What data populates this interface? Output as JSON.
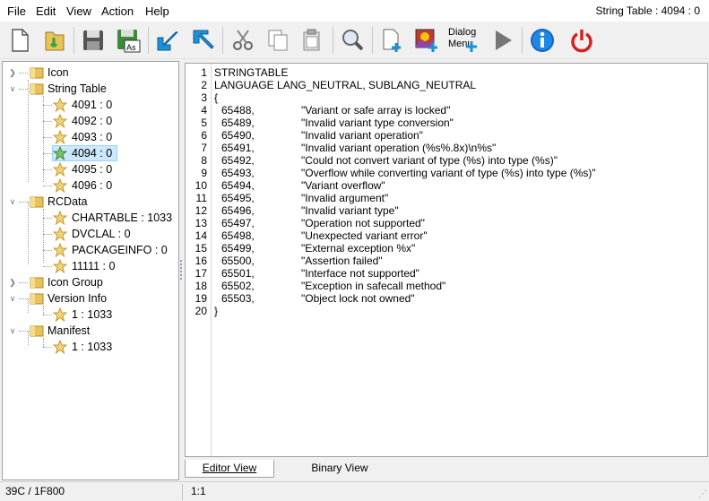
{
  "menu": {
    "file": "File",
    "edit": "Edit",
    "view": "View",
    "action": "Action",
    "help": "Help"
  },
  "window_status": "String Table : 4094 : 0",
  "toolbar": {
    "dialog_label_1": "Dialog",
    "dialog_label_2": "Menu",
    "icons": [
      "new-file-icon",
      "open-folder-icon",
      "save-icon",
      "save-as-icon",
      "arrow-back-icon",
      "arrow-forward-icon",
      "cut-icon",
      "copy-icon",
      "paste-icon",
      "search-icon",
      "add-resource-icon",
      "add-image-icon",
      "add-dialog-menu-icon",
      "play-icon",
      "info-icon",
      "power-icon"
    ]
  },
  "tree": {
    "icon": "Icon",
    "string_table": "String Table",
    "st_items": [
      "4091 : 0",
      "4092 : 0",
      "4093 : 0",
      "4094 : 0",
      "4095 : 0",
      "4096 : 0"
    ],
    "rcdata": "RCData",
    "rc_items": [
      "CHARTABLE : 1033",
      "DVCLAL : 0",
      "PACKAGEINFO : 0",
      "11111 : 0"
    ],
    "icon_group": "Icon Group",
    "version_info": "Version Info",
    "vi_items": [
      "1 : 1033"
    ],
    "manifest": "Manifest",
    "mf_items": [
      "1 : 1033"
    ]
  },
  "editor": {
    "line1": "STRINGTABLE",
    "line2": "LANGUAGE LANG_NEUTRAL, SUBLANG_NEUTRAL",
    "line3": "{",
    "entries": [
      {
        "id": "65488,",
        "text": "\"Variant or safe array is locked\""
      },
      {
        "id": "65489,",
        "text": "\"Invalid variant type conversion\""
      },
      {
        "id": "65490,",
        "text": "\"Invalid variant operation\""
      },
      {
        "id": "65491,",
        "text": "\"Invalid variant operation (%s%.8x)\\n%s\""
      },
      {
        "id": "65492,",
        "text": "\"Could not convert variant of type (%s) into type (%s)\""
      },
      {
        "id": "65493,",
        "text": "\"Overflow while converting variant of type (%s) into type (%s)\""
      },
      {
        "id": "65494,",
        "text": "\"Variant overflow\""
      },
      {
        "id": "65495,",
        "text": "\"Invalid argument\""
      },
      {
        "id": "65496,",
        "text": "\"Invalid variant type\""
      },
      {
        "id": "65497,",
        "text": "\"Operation not supported\""
      },
      {
        "id": "65498,",
        "text": "\"Unexpected variant error\""
      },
      {
        "id": "65499,",
        "text": "\"External exception %x\""
      },
      {
        "id": "65500,",
        "text": "\"Assertion failed\""
      },
      {
        "id": "65501,",
        "text": "\"Interface not supported\""
      },
      {
        "id": "65502,",
        "text": "\"Exception in safecall method\""
      },
      {
        "id": "65503,",
        "text": "\"Object lock not owned\""
      }
    ],
    "line20": "}",
    "line_numbers": [
      "1",
      "2",
      "3",
      "4",
      "5",
      "6",
      "7",
      "8",
      "9",
      "10",
      "11",
      "12",
      "13",
      "14",
      "15",
      "16",
      "17",
      "18",
      "19",
      "20"
    ]
  },
  "tabs": {
    "editor_view": "Editor View",
    "binary_view": "Binary View"
  },
  "status": {
    "left": "39C / 1F800",
    "position": "1:1"
  },
  "colors": {
    "selection": "#cce8ff",
    "folder": "#e8c25a",
    "star": "#f2d27a",
    "accent_blue": "#1e90d6",
    "power_red": "#d42020"
  }
}
